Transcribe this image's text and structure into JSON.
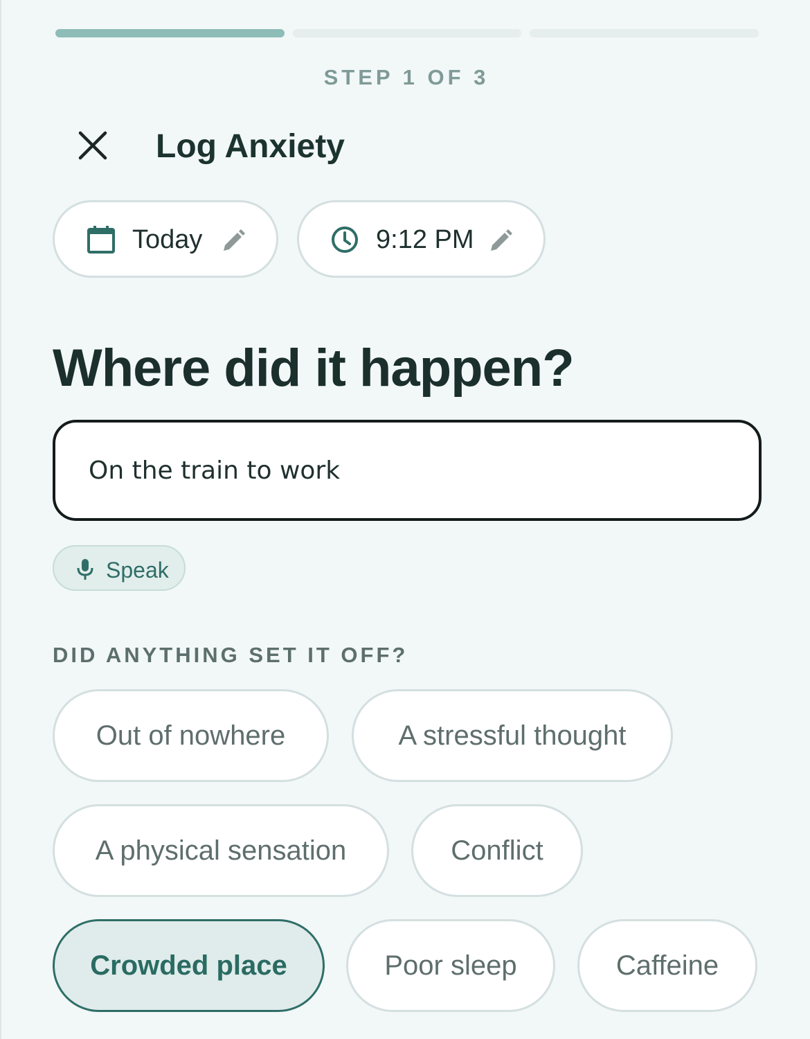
{
  "progress": {
    "current_step": 1,
    "total_steps": 3
  },
  "header": {
    "step_label": "STEP 1 OF 3",
    "title": "Log Anxiety",
    "close_icon": "close-icon"
  },
  "meta": {
    "date_label": "Today",
    "time_label": "9:12 PM",
    "date_icon": "calendar-icon",
    "time_icon": "clock-icon",
    "edit_icon": "pencil-icon"
  },
  "question": {
    "text": "Where did it happen?"
  },
  "location_input": {
    "value": "On the train to work"
  },
  "speak": {
    "label": "Speak",
    "icon": "mic-icon"
  },
  "triggers": {
    "label": "DID ANYTHING SET IT OFF?",
    "options": [
      {
        "label": "Out of nowhere",
        "selected": false
      },
      {
        "label": "A stressful thought",
        "selected": false
      },
      {
        "label": "A physical sensation",
        "selected": false
      },
      {
        "label": "Conflict",
        "selected": false
      },
      {
        "label": "Crowded place",
        "selected": true
      },
      {
        "label": "Poor sleep",
        "selected": false
      },
      {
        "label": "Caffeine",
        "selected": false
      }
    ]
  },
  "colors": {
    "background": "#f2f7f8",
    "accent": "#2f6e67",
    "progress_fill": "#8ebcb6",
    "selected_chip_bg": "#dfeceb"
  }
}
